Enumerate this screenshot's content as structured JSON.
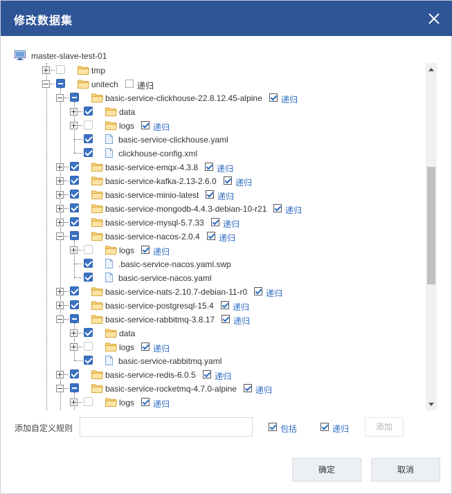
{
  "dialog": {
    "title": "修改数据集",
    "close_icon": "close-icon"
  },
  "tree": {
    "root_label": "master-slave-test-01",
    "recursive_label": "递归",
    "rows": [
      {
        "level": 1,
        "toggle": "plus",
        "check": "empty",
        "type": "folder",
        "label": "tmp"
      },
      {
        "level": 1,
        "toggle": "minus",
        "check": "partial",
        "type": "folder",
        "label": "unitech",
        "recursive": "off"
      },
      {
        "level": 2,
        "toggle": "minus",
        "check": "partial",
        "type": "folder",
        "label": "basic-service-clickhouse-22.8.12.45-alpine",
        "recursive": "on"
      },
      {
        "level": 3,
        "toggle": "plus",
        "check": "checked",
        "type": "folder",
        "label": "data"
      },
      {
        "level": 3,
        "toggle": "plus",
        "check": "empty",
        "type": "folder",
        "label": "logs",
        "recursive": "on"
      },
      {
        "level": 3,
        "toggle": "none",
        "check": "checked",
        "type": "file",
        "label": "basic-service-clickhouse.yaml"
      },
      {
        "level": 3,
        "toggle": "none",
        "check": "checked",
        "type": "file",
        "label": "clickhouse-config.xml"
      },
      {
        "level": 2,
        "toggle": "plus",
        "check": "checked",
        "type": "folder",
        "label": "basic-service-emqx-4.3.8",
        "recursive": "on"
      },
      {
        "level": 2,
        "toggle": "plus",
        "check": "checked",
        "type": "folder",
        "label": "basic-service-kafka-2.13-2.6.0",
        "recursive": "on"
      },
      {
        "level": 2,
        "toggle": "plus",
        "check": "checked",
        "type": "folder",
        "label": "basic-service-minio-latest",
        "recursive": "on"
      },
      {
        "level": 2,
        "toggle": "plus",
        "check": "checked",
        "type": "folder",
        "label": "basic-service-mongodb-4.4.3-debian-10-r21",
        "recursive": "on"
      },
      {
        "level": 2,
        "toggle": "plus",
        "check": "checked",
        "type": "folder",
        "label": "basic-service-mysql-5.7.33",
        "recursive": "on"
      },
      {
        "level": 2,
        "toggle": "minus",
        "check": "partial",
        "type": "folder",
        "label": "basic-service-nacos-2.0.4",
        "recursive": "on"
      },
      {
        "level": 3,
        "toggle": "plus",
        "check": "empty",
        "type": "folder",
        "label": "logs",
        "recursive": "on"
      },
      {
        "level": 3,
        "toggle": "none",
        "check": "checked",
        "type": "file",
        "label": ".basic-service-nacos.yaml.swp"
      },
      {
        "level": 3,
        "toggle": "none",
        "check": "checked",
        "type": "file",
        "label": "basic-service-nacos.yaml"
      },
      {
        "level": 2,
        "toggle": "plus",
        "check": "checked",
        "type": "folder",
        "label": "basic-service-nats-2.10.7-debian-11-r0",
        "recursive": "on"
      },
      {
        "level": 2,
        "toggle": "plus",
        "check": "checked",
        "type": "folder",
        "label": "basic-service-postgresql-15.4",
        "recursive": "on"
      },
      {
        "level": 2,
        "toggle": "minus",
        "check": "partial",
        "type": "folder",
        "label": "basic-service-rabbitmq-3.8.17",
        "recursive": "on"
      },
      {
        "level": 3,
        "toggle": "plus",
        "check": "checked",
        "type": "folder",
        "label": "data"
      },
      {
        "level": 3,
        "toggle": "plus",
        "check": "empty",
        "type": "folder",
        "label": "logs",
        "recursive": "on"
      },
      {
        "level": 3,
        "toggle": "none",
        "check": "checked",
        "type": "file",
        "label": "basic-service-rabbitmq.yaml"
      },
      {
        "level": 2,
        "toggle": "plus",
        "check": "checked",
        "type": "folder",
        "label": "basic-service-redis-6.0.5",
        "recursive": "on"
      },
      {
        "level": 2,
        "toggle": "minus",
        "check": "partial",
        "type": "folder",
        "label": "basic-service-rocketmq-4.7.0-alpine",
        "recursive": "on"
      },
      {
        "level": 3,
        "toggle": "plus",
        "check": "empty",
        "type": "folder",
        "label": "logs",
        "recursive": "on"
      }
    ]
  },
  "rule": {
    "label": "添加自定义规则",
    "input_value": "",
    "include_label": "包括",
    "recursive_label": "递归",
    "add_label": "添加"
  },
  "footer": {
    "ok_label": "确定",
    "cancel_label": "取消"
  },
  "colors": {
    "titlebar": "#2f5597",
    "checkbox": "#3a72c4",
    "link": "#2d6bc2",
    "folder": "#f2c457"
  }
}
